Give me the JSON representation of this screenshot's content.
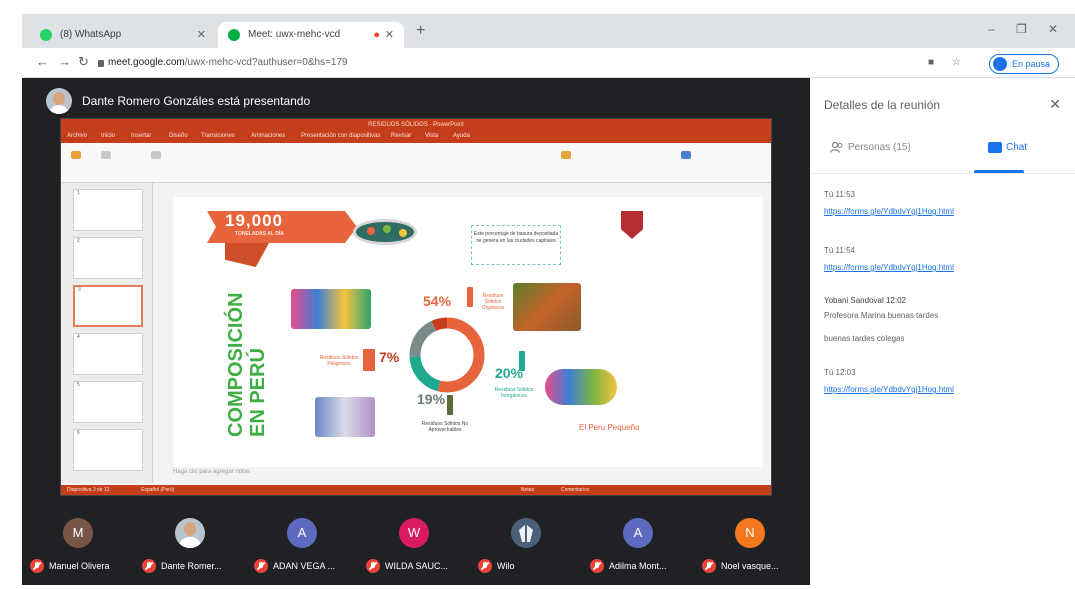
{
  "browser": {
    "tabs": [
      {
        "label": "(8) WhatsApp",
        "color": "#25d366"
      },
      {
        "label": "Meet: uwx-mehc-vcd",
        "color": "#00ac47"
      }
    ],
    "new_tab": "+",
    "url_host": "meet.google.com",
    "url_path": "/uwx-mehc-vcd?authuser=0&hs=179",
    "profile_label": "En pausa",
    "window_controls": [
      "–",
      "❐",
      "✕"
    ]
  },
  "meet": {
    "presenter_banner": "Dante Romero Gonzáles está presentando",
    "participants": [
      {
        "initial": "M",
        "name": "Manuel Olivera",
        "color": "#795548",
        "photo": false
      },
      {
        "initial": "",
        "name": "Dante Romer...",
        "color": "#b9c4cf",
        "photo": true
      },
      {
        "initial": "A",
        "name": "ADAN VEGA ...",
        "color": "#5c6bc0",
        "photo": false
      },
      {
        "initial": "W",
        "name": "WILDA SAUC...",
        "color": "#d81b60",
        "photo": false
      },
      {
        "initial": "",
        "name": "Wilo",
        "color": "#4a5f78",
        "photo": false
      },
      {
        "initial": "A",
        "name": "Adilma Mont...",
        "color": "#5c6bc0",
        "photo": false
      },
      {
        "initial": "N",
        "name": "Noel vasque...",
        "color": "#f4781e",
        "photo": false
      }
    ]
  },
  "slide": {
    "window_title": "RESIDUOS SÓLIDOS - PowerPoint",
    "ribbon_tabs": [
      "Archivo",
      "Inicio",
      "Insertar",
      "Diseño",
      "Transiciones",
      "Animaciones",
      "Presentación con diapositivas",
      "Revisar",
      "Vista",
      "Ayuda"
    ],
    "big_number": "19,000",
    "big_number_sub": "TONELADAS AL DÍA",
    "callout": "Este porcentaje de basura depositada se genera en las ciudades capitales",
    "vertical_title_1": "COMPOSICIÓN",
    "vertical_title_2": "EN PERÚ",
    "slices": [
      {
        "pct": "54%",
        "label": "Residuos Sólidos Orgánicos",
        "color": "#e8643c"
      },
      {
        "pct": "20%",
        "label": "Residuos Sólidos Inorgánicos",
        "color": "#1fa98e"
      },
      {
        "pct": "19%",
        "label": "Residuos Sólidos No Aprovechables",
        "color": "#7b8a8b"
      },
      {
        "pct": "7%",
        "label": "Residuos Sólidos Peligrosos",
        "color": "#e8643c"
      }
    ],
    "brand": "El Peru Pequeño",
    "notes_placeholder": "Haga clic para agregar notas",
    "status": [
      "Diapositiva 3 de 12",
      "Español (Perú)",
      "Notas",
      "Comentarios"
    ]
  },
  "panel": {
    "title": "Detalles de la reunión",
    "close": "✕",
    "tab_people": "Personas (15)",
    "tab_chat": "Chat",
    "messages": [
      {
        "who": "Tú  11:53",
        "text": "",
        "link": "https://forms.gle/YdbdvYgj1Hog.html"
      },
      {
        "who": "Tú  11:54",
        "text": "",
        "link": "https://forms.gle/YdbdvYgj1Hog.html"
      },
      {
        "who": "Yobani Sandoval  12:02",
        "text": "Profesora Marina buenas tardes",
        "extra": "buenas tardes colegas",
        "link": ""
      },
      {
        "who": "Tú  12:03",
        "text": "",
        "link": "https://forms.gle/YdbdvYgj1Hog.html"
      }
    ]
  }
}
